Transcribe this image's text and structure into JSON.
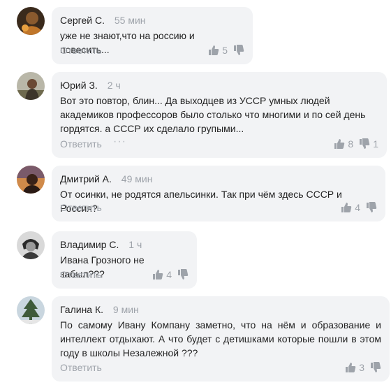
{
  "reply_label": "Ответить",
  "comments": [
    {
      "author": "Сергей С.",
      "time": "55 мин",
      "text": "уже не знают,что на россию и повесить...",
      "likes": "5",
      "dislikes": "",
      "has_more": false
    },
    {
      "author": "Юрий З.",
      "time": "2 ч",
      "text": "Вот это повтор, блин... Да выходцев из УССР умных людей академиков профессоров было столько что многими и по сей день гордятся. а СССР их сделало групыми...",
      "likes": "8",
      "dislikes": "1",
      "has_more": true
    },
    {
      "author": "Дмитрий А.",
      "time": "49 мин",
      "text": "От осинки, не родятся апельсинки. Так при чём здесь СССР и Россия?",
      "likes": "4",
      "dislikes": "",
      "has_more": false
    },
    {
      "author": "Владимир С.",
      "time": "1 ч",
      "text": "Ивана Грозного не забыл???",
      "likes": "4",
      "dislikes": "",
      "has_more": false
    },
    {
      "author": "Галина К.",
      "time": "9 мин",
      "text": "По самому Ивану Компану заметно, что на нём и образование и интеллект отдыхают. А что будет с детишками которые пошли в этом году в школы Незалежной ???",
      "likes": "3",
      "dislikes": "",
      "has_more": false
    }
  ],
  "colors": {
    "bubble": "#f2f3f5",
    "muted": "#9ea3aa",
    "text": "#222222"
  }
}
